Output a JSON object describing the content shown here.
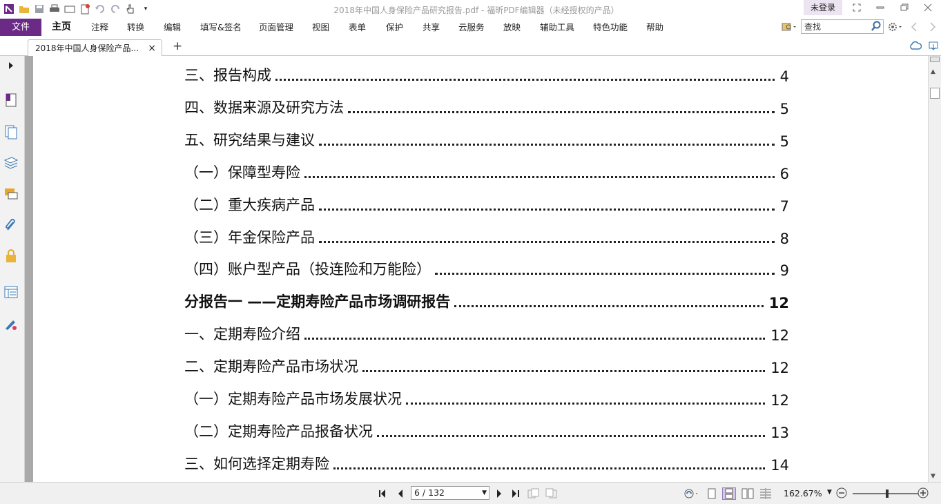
{
  "window": {
    "title": "2018年中国人身保险产品研究报告.pdf - 福昕PDF编辑器（未经授权的产品）",
    "login_label": "未登录"
  },
  "menu": {
    "file": "文件",
    "items": [
      "主页",
      "注释",
      "转换",
      "编辑",
      "填写&签名",
      "页面管理",
      "视图",
      "表单",
      "保护",
      "共享",
      "云服务",
      "放映",
      "辅助工具",
      "特色功能",
      "帮助"
    ]
  },
  "search": {
    "value": "查找"
  },
  "tabs": {
    "doc_tab": "2018年中国人身保险产品...",
    "close": "×",
    "new": "+"
  },
  "toc": [
    {
      "title": "三、报告构成",
      "page": "4",
      "bold": false
    },
    {
      "title": "四、数据来源及研究方法",
      "page": "5",
      "bold": false
    },
    {
      "title": "五、研究结果与建议",
      "page": "5",
      "bold": false
    },
    {
      "title": "（一）保障型寿险",
      "page": "6",
      "bold": false
    },
    {
      "title": "（二）重大疾病产品",
      "page": "7",
      "bold": false
    },
    {
      "title": "（三）年金保险产品",
      "page": "8",
      "bold": false
    },
    {
      "title": "（四）账户型产品（投连险和万能险）",
      "page": "9",
      "bold": false
    },
    {
      "title": "分报告一 ——定期寿险产品市场调研报告",
      "page": "12",
      "bold": true
    },
    {
      "title": "一、定期寿险介绍",
      "page": "12",
      "bold": false
    },
    {
      "title": "二、定期寿险产品市场状况",
      "page": "12",
      "bold": false
    },
    {
      "title": "（一）定期寿险产品市场发展状况",
      "page": "12",
      "bold": false
    },
    {
      "title": "（二）定期寿险产品报备状况",
      "page": "13",
      "bold": false
    },
    {
      "title": "三、如何选择定期寿险",
      "page": "14",
      "bold": false
    }
  ],
  "status": {
    "page_indicator": "6 / 132",
    "zoom": "162.67%"
  },
  "colors": {
    "accent": "#6a2a85",
    "toolbar_bg": "#f0f0f0"
  }
}
